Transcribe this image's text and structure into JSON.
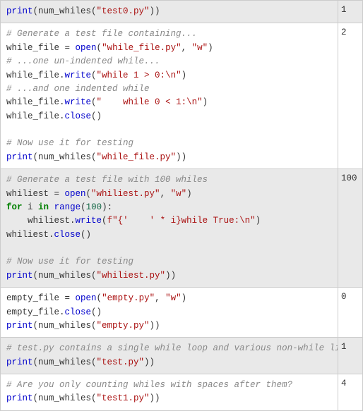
{
  "rows": [
    {
      "tokens": [
        {
          "cls": "fn",
          "t": "print"
        },
        {
          "cls": "plain",
          "t": "(num_whiles("
        },
        {
          "cls": "str",
          "t": "\"test0.py\""
        },
        {
          "cls": "plain",
          "t": "))"
        }
      ],
      "output": "1"
    },
    {
      "tokens": [
        {
          "cls": "cmt",
          "t": "# Generate a test file containing..."
        },
        {
          "cls": "plain",
          "t": "\n"
        },
        {
          "cls": "plain",
          "t": "while_file = "
        },
        {
          "cls": "fn",
          "t": "open"
        },
        {
          "cls": "plain",
          "t": "("
        },
        {
          "cls": "str",
          "t": "\"while_file.py\""
        },
        {
          "cls": "plain",
          "t": ", "
        },
        {
          "cls": "str",
          "t": "\"w\""
        },
        {
          "cls": "plain",
          "t": ")"
        },
        {
          "cls": "plain",
          "t": "\n"
        },
        {
          "cls": "cmt",
          "t": "# ...one un-indented while..."
        },
        {
          "cls": "plain",
          "t": "\n"
        },
        {
          "cls": "plain",
          "t": "while_file."
        },
        {
          "cls": "fn",
          "t": "write"
        },
        {
          "cls": "plain",
          "t": "("
        },
        {
          "cls": "str",
          "t": "\"while 1 > 0:\\n\""
        },
        {
          "cls": "plain",
          "t": ")"
        },
        {
          "cls": "plain",
          "t": "\n"
        },
        {
          "cls": "cmt",
          "t": "# ...and one indented while"
        },
        {
          "cls": "plain",
          "t": "\n"
        },
        {
          "cls": "plain",
          "t": "while_file."
        },
        {
          "cls": "fn",
          "t": "write"
        },
        {
          "cls": "plain",
          "t": "("
        },
        {
          "cls": "str",
          "t": "\"    while 0 < 1:\\n\""
        },
        {
          "cls": "plain",
          "t": ")"
        },
        {
          "cls": "plain",
          "t": "\n"
        },
        {
          "cls": "plain",
          "t": "while_file."
        },
        {
          "cls": "fn",
          "t": "close"
        },
        {
          "cls": "plain",
          "t": "()"
        },
        {
          "cls": "plain",
          "t": "\n"
        },
        {
          "cls": "plain",
          "t": "\n"
        },
        {
          "cls": "cmt",
          "t": "# Now use it for testing"
        },
        {
          "cls": "plain",
          "t": "\n"
        },
        {
          "cls": "fn",
          "t": "print"
        },
        {
          "cls": "plain",
          "t": "(num_whiles("
        },
        {
          "cls": "str",
          "t": "\"while_file.py\""
        },
        {
          "cls": "plain",
          "t": "))"
        }
      ],
      "output": "2"
    },
    {
      "tokens": [
        {
          "cls": "cmt",
          "t": "# Generate a test file with 100 whiles"
        },
        {
          "cls": "plain",
          "t": "\n"
        },
        {
          "cls": "plain",
          "t": "whiliest = "
        },
        {
          "cls": "fn",
          "t": "open"
        },
        {
          "cls": "plain",
          "t": "("
        },
        {
          "cls": "str",
          "t": "\"whiliest.py\""
        },
        {
          "cls": "plain",
          "t": ", "
        },
        {
          "cls": "str",
          "t": "\"w\""
        },
        {
          "cls": "plain",
          "t": ")"
        },
        {
          "cls": "plain",
          "t": "\n"
        },
        {
          "cls": "kw",
          "t": "for"
        },
        {
          "cls": "plain",
          "t": " i "
        },
        {
          "cls": "kw",
          "t": "in"
        },
        {
          "cls": "plain",
          "t": " "
        },
        {
          "cls": "fn",
          "t": "range"
        },
        {
          "cls": "plain",
          "t": "("
        },
        {
          "cls": "num",
          "t": "100"
        },
        {
          "cls": "plain",
          "t": "):"
        },
        {
          "cls": "plain",
          "t": "\n"
        },
        {
          "cls": "plain",
          "t": "    whiliest."
        },
        {
          "cls": "fn",
          "t": "write"
        },
        {
          "cls": "plain",
          "t": "("
        },
        {
          "cls": "str",
          "t": "f\"{'    ' * i}while True:\\n\""
        },
        {
          "cls": "plain",
          "t": ")"
        },
        {
          "cls": "plain",
          "t": "\n"
        },
        {
          "cls": "plain",
          "t": "whiliest."
        },
        {
          "cls": "fn",
          "t": "close"
        },
        {
          "cls": "plain",
          "t": "()"
        },
        {
          "cls": "plain",
          "t": "\n"
        },
        {
          "cls": "plain",
          "t": "\n"
        },
        {
          "cls": "cmt",
          "t": "# Now use it for testing"
        },
        {
          "cls": "plain",
          "t": "\n"
        },
        {
          "cls": "fn",
          "t": "print"
        },
        {
          "cls": "plain",
          "t": "(num_whiles("
        },
        {
          "cls": "str",
          "t": "\"whiliest.py\""
        },
        {
          "cls": "plain",
          "t": "))"
        }
      ],
      "output": "100"
    },
    {
      "tokens": [
        {
          "cls": "plain",
          "t": "empty_file = "
        },
        {
          "cls": "fn",
          "t": "open"
        },
        {
          "cls": "plain",
          "t": "("
        },
        {
          "cls": "str",
          "t": "\"empty.py\""
        },
        {
          "cls": "plain",
          "t": ", "
        },
        {
          "cls": "str",
          "t": "\"w\""
        },
        {
          "cls": "plain",
          "t": ")"
        },
        {
          "cls": "plain",
          "t": "\n"
        },
        {
          "cls": "plain",
          "t": "empty_file."
        },
        {
          "cls": "fn",
          "t": "close"
        },
        {
          "cls": "plain",
          "t": "()"
        },
        {
          "cls": "plain",
          "t": "\n"
        },
        {
          "cls": "fn",
          "t": "print"
        },
        {
          "cls": "plain",
          "t": "(num_whiles("
        },
        {
          "cls": "str",
          "t": "\"empty.py\""
        },
        {
          "cls": "plain",
          "t": "))"
        }
      ],
      "output": "0"
    },
    {
      "tokens": [
        {
          "cls": "cmt",
          "t": "# test.py contains a single while loop and various non-while lines."
        },
        {
          "cls": "plain",
          "t": "\n"
        },
        {
          "cls": "fn",
          "t": "print"
        },
        {
          "cls": "plain",
          "t": "(num_whiles("
        },
        {
          "cls": "str",
          "t": "\"test.py\""
        },
        {
          "cls": "plain",
          "t": "))"
        }
      ],
      "output": "1"
    },
    {
      "tokens": [
        {
          "cls": "cmt",
          "t": "# Are you only counting whiles with spaces after them?"
        },
        {
          "cls": "plain",
          "t": "\n"
        },
        {
          "cls": "fn",
          "t": "print"
        },
        {
          "cls": "plain",
          "t": "(num_whiles("
        },
        {
          "cls": "str",
          "t": "\"test1.py\""
        },
        {
          "cls": "plain",
          "t": "))"
        }
      ],
      "output": "4"
    }
  ]
}
